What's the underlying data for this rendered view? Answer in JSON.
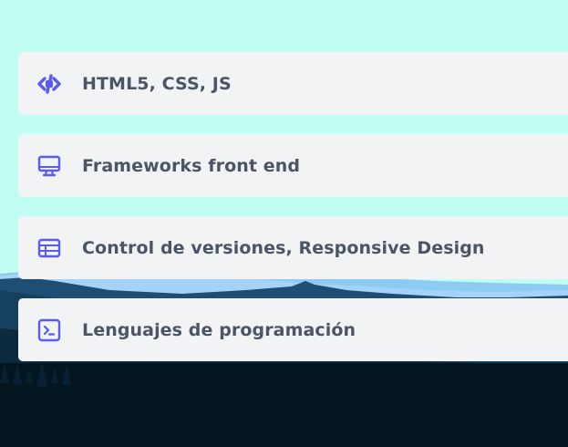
{
  "theme": {
    "accent": "#5b5bf0",
    "card_bg": "#f2f3f5",
    "text": "#4b5563",
    "sky": "#c0fdf3"
  },
  "skills": {
    "items": [
      {
        "label": "HTML5, CSS, JS",
        "icon": "code-icon"
      },
      {
        "label": "Frameworks front end",
        "icon": "desktop-icon"
      },
      {
        "label": "Control de versiones, Responsive Design",
        "icon": "table-icon"
      },
      {
        "label": "Lenguajes de programación",
        "icon": "terminal-icon"
      }
    ]
  }
}
